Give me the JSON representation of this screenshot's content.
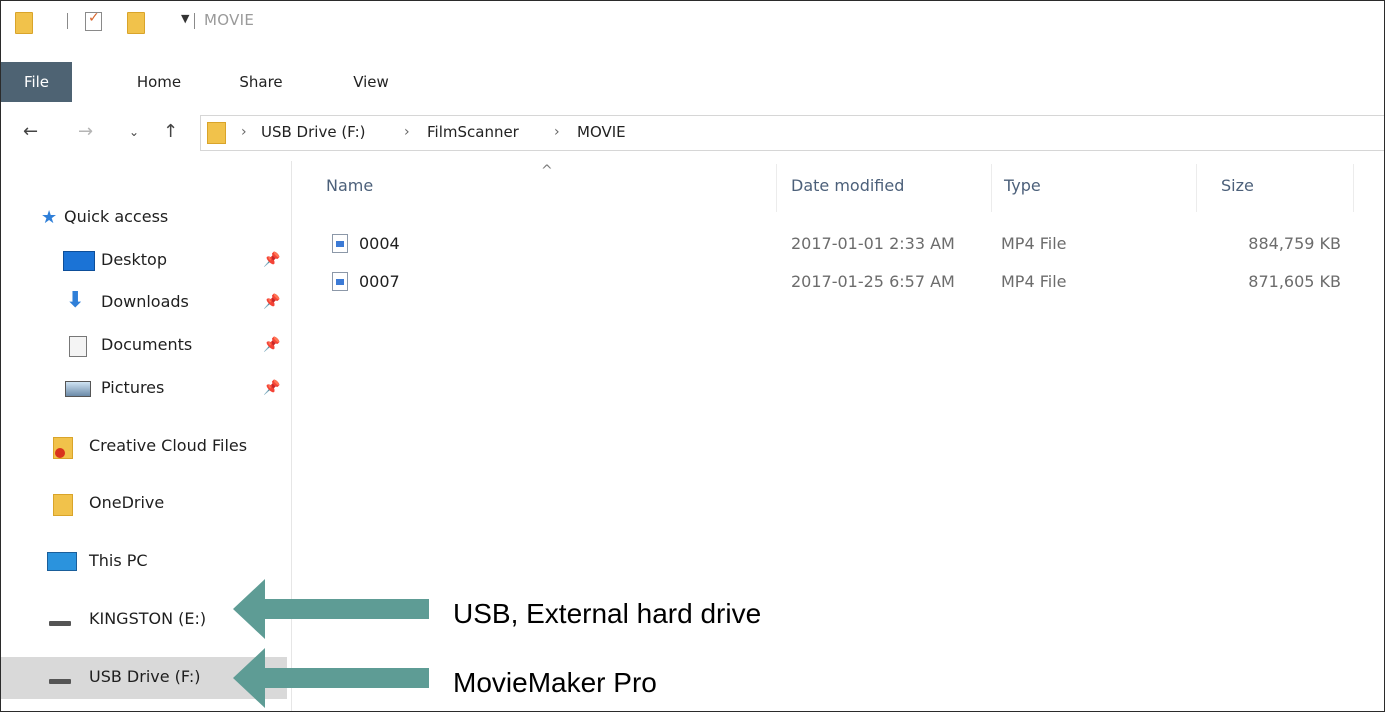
{
  "window": {
    "title": "MOVIE"
  },
  "ribbon": {
    "tabs": [
      {
        "label": "File",
        "active": true
      },
      {
        "label": "Home"
      },
      {
        "label": "Share"
      },
      {
        "label": "View"
      }
    ]
  },
  "address_bar": {
    "breadcrumbs": [
      "USB Drive (F:)",
      "FilmScanner",
      "MOVIE"
    ]
  },
  "nav_pane": {
    "quick_access": "Quick access",
    "pinned": [
      {
        "label": "Desktop",
        "icon": "desktop-icon"
      },
      {
        "label": "Downloads",
        "icon": "download-arrow-icon"
      },
      {
        "label": "Documents",
        "icon": "documents-icon"
      },
      {
        "label": "Pictures",
        "icon": "pictures-icon"
      }
    ],
    "creative_cloud": "Creative Cloud Files",
    "onedrive": "OneDrive",
    "this_pc": "This PC",
    "drives": [
      {
        "label": "KINGSTON (E:)",
        "selected": false
      },
      {
        "label": "USB Drive (F:)",
        "selected": true
      }
    ]
  },
  "file_list": {
    "columns": [
      "Name",
      "Date modified",
      "Type",
      "Size"
    ],
    "sort_indicator": "^",
    "rows": [
      {
        "name": "0004",
        "date": "2017-01-01 2:33 AM",
        "type": "MP4 File",
        "size": "884,759 KB"
      },
      {
        "name": "0007",
        "date": "2017-01-25 6:57 AM",
        "type": "MP4 File",
        "size": "871,605 KB"
      }
    ]
  },
  "annotations": [
    {
      "text": "USB, External hard drive"
    },
    {
      "text": "MovieMaker Pro"
    }
  ],
  "colors": {
    "active_tab": "#4e6373",
    "arrow": "#5e9c95",
    "folder": "#f1c24b",
    "selected_row": "#d9d9d9"
  }
}
